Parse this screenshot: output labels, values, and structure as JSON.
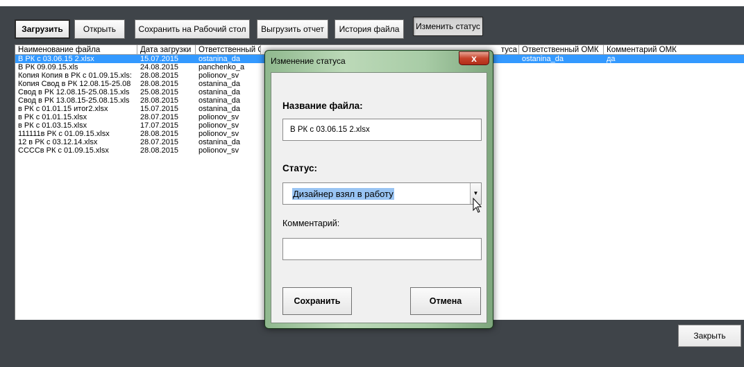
{
  "toolbar": {
    "upload_label": "Загрузить",
    "open_label": "Открыть",
    "save_desktop_label": "Сохранить на Рабочий стол",
    "export_report_label": "Выгрузить отчет",
    "history_label": "История файла",
    "change_status_label": "Изменить статус"
  },
  "table": {
    "headers": {
      "file_name": "Наименование файла",
      "upload_date": "Дата загрузки",
      "responsible": "Ответственный ОМК",
      "status_fragment": "туса",
      "responsible_omk": "Ответственный ОМК",
      "comment_omk": "Комментарий ОМК"
    },
    "rows": [
      {
        "name": "В РК с 03.06.15 2.xlsx",
        "date": "15.07.2015",
        "resp": "ostanina_da",
        "resp_omk": "ostanina_da",
        "comment": "да"
      },
      {
        "name": "В РК 09.09.15.xls",
        "date": "24.08.2015",
        "resp": "panchenko_a",
        "resp_omk": "",
        "comment": ""
      },
      {
        "name": "Копия Копия в РК с 01.09.15.xls:",
        "date": "28.08.2015",
        "resp": "polionov_sv",
        "resp_omk": "",
        "comment": ""
      },
      {
        "name": "Копия Свод в РК 12.08.15-25.08",
        "date": "28.08.2015",
        "resp": "ostanina_da",
        "resp_omk": "",
        "comment": ""
      },
      {
        "name": "Свод в РК 12.08.15-25.08.15.xls",
        "date": "25.08.2015",
        "resp": "ostanina_da",
        "resp_omk": "",
        "comment": ""
      },
      {
        "name": "Свод в РК 13.08.15-25.08.15.xls",
        "date": "28.08.2015",
        "resp": "ostanina_da",
        "resp_omk": "",
        "comment": ""
      },
      {
        "name": "в РК с 01.01.15 итог2.xlsx",
        "date": "15.07.2015",
        "resp": "ostanina_da",
        "resp_omk": "",
        "comment": ""
      },
      {
        "name": "в РК с 01.01.15.xlsx",
        "date": "28.07.2015",
        "resp": "polionov_sv",
        "resp_omk": "",
        "comment": ""
      },
      {
        "name": "в РК с 01.03.15.xlsx",
        "date": "17.07.2015",
        "resp": "polionov_sv",
        "resp_omk": "",
        "comment": ""
      },
      {
        "name": "111111в РК с 01.09.15.xlsx",
        "date": "28.08.2015",
        "resp": "polionov_sv",
        "resp_omk": "",
        "comment": ""
      },
      {
        "name": "12 в РК с 03.12.14.xlsx",
        "date": "28.07.2015",
        "resp": "ostanina_da",
        "resp_omk": "",
        "comment": ""
      },
      {
        "name": "СССCв РК с 01.09.15.xlsx",
        "date": "28.08.2015",
        "resp": "polionov_sv",
        "resp_omk": "",
        "comment": ""
      }
    ]
  },
  "close_label": "Закрыть",
  "dialog": {
    "title": "Изменение статуса",
    "close_glyph": "x",
    "file_name_label": "Название файла:",
    "file_name_value": "В РК с 03.06.15 2.xlsx",
    "status_label": "Статус:",
    "status_value": "Дизайнер взял в работу",
    "comment_label": "Комментарий:",
    "comment_value": "",
    "save_label": "Сохранить",
    "cancel_label": "Отмена"
  },
  "colors": {
    "selection": "#3399ff",
    "background": "#3f4449",
    "dialog_frame": "#a8cca6"
  },
  "icons": [
    "chevron-down-icon",
    "close-icon",
    "mouse-cursor-icon"
  ]
}
